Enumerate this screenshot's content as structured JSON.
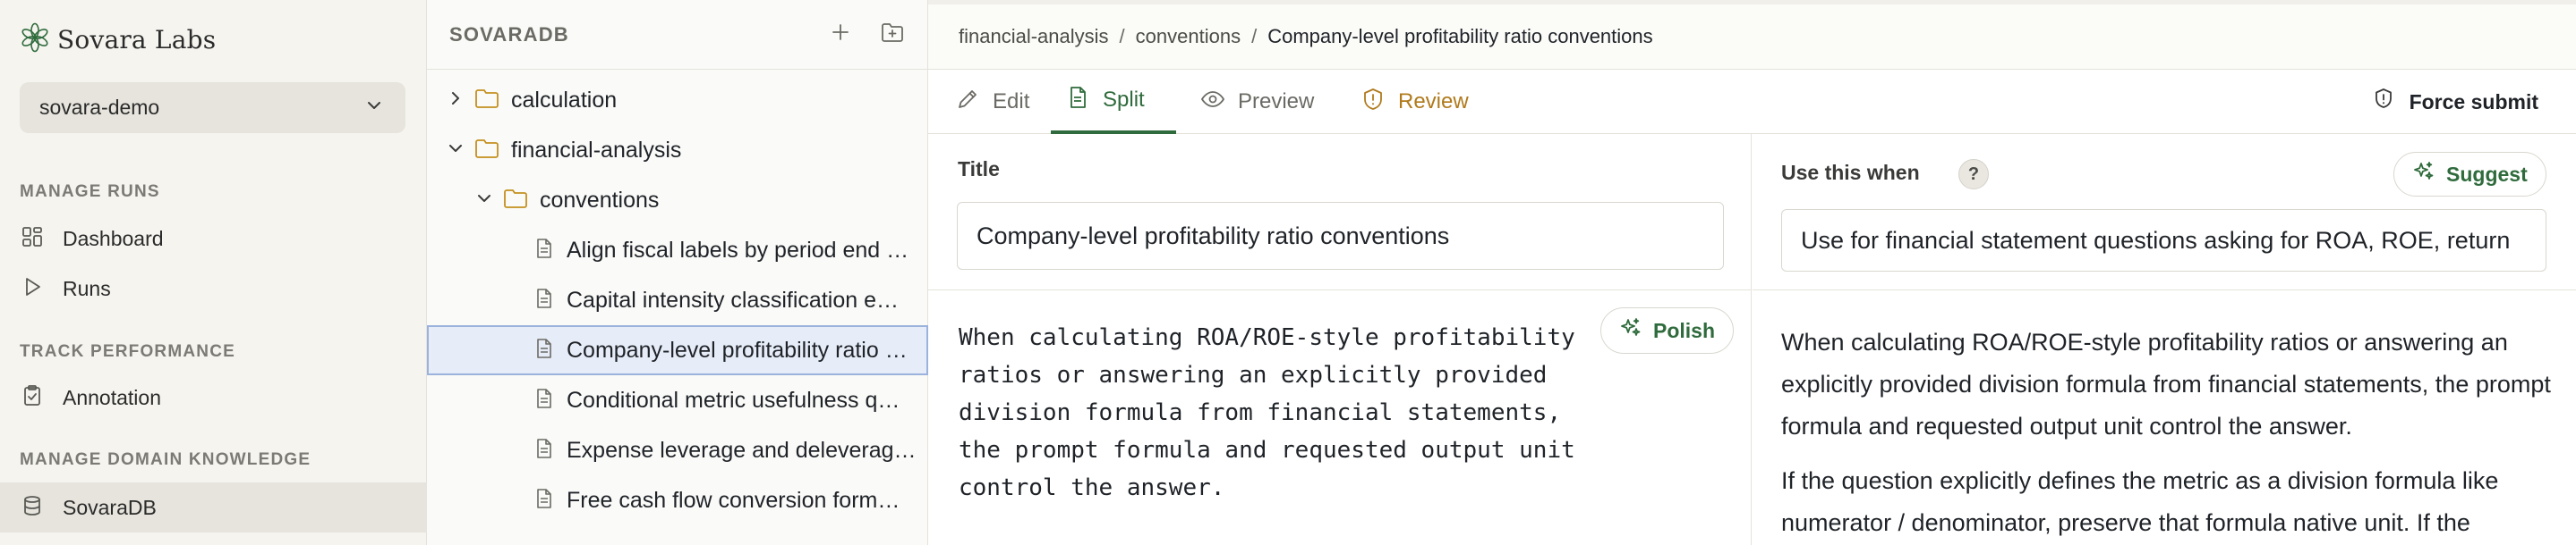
{
  "app": {
    "brand": "Sovara Labs",
    "workspace": "sovara-demo"
  },
  "sidebar": {
    "sections": [
      {
        "title": "MANAGE RUNS",
        "items": [
          {
            "label": "Dashboard",
            "icon": "dashboard-icon"
          },
          {
            "label": "Runs",
            "icon": "play-icon"
          }
        ]
      },
      {
        "title": "TRACK PERFORMANCE",
        "items": [
          {
            "label": "Annotation",
            "icon": "clipboard-check-icon"
          }
        ]
      },
      {
        "title": "MANAGE DOMAIN KNOWLEDGE",
        "items": [
          {
            "label": "SovaraDB",
            "icon": "database-icon",
            "active": true
          }
        ]
      }
    ]
  },
  "tree": {
    "title": "SOVARADB",
    "rows": [
      {
        "label": "calculation",
        "type": "folder",
        "expanded": false
      },
      {
        "label": "financial-analysis",
        "type": "folder",
        "expanded": true
      },
      {
        "label": "conventions",
        "type": "folder",
        "expanded": true
      },
      {
        "label": "Align fiscal labels by period end …",
        "type": "doc"
      },
      {
        "label": "Capital intensity classification e…",
        "type": "doc"
      },
      {
        "label": "Company-level profitability ratio …",
        "type": "doc",
        "selected": true
      },
      {
        "label": "Conditional metric usefulness q…",
        "type": "doc"
      },
      {
        "label": "Expense leverage and deleverag…",
        "type": "doc"
      },
      {
        "label": "Free cash flow conversion form…",
        "type": "doc"
      }
    ]
  },
  "breadcrumb": {
    "items": [
      "financial-analysis",
      "conventions"
    ],
    "current": "Company-level profitability ratio conventions",
    "separator": "/"
  },
  "toolbar": {
    "tabs": [
      {
        "label": "Edit",
        "icon": "pencil-icon"
      },
      {
        "label": "Split",
        "icon": "file-text-icon",
        "active": true
      },
      {
        "label": "Preview",
        "icon": "eye-icon"
      },
      {
        "label": "Review",
        "icon": "alert-circle-icon"
      }
    ],
    "force_submit": "Force submit"
  },
  "editor": {
    "title_label": "Title",
    "title_value": "Company-level profitability ratio conventions",
    "body": "When calculating ROA/ROE-style profitability\nratios or answering an explicitly provided\ndivision formula from financial statements,\nthe prompt formula and requested output unit\ncontrol the answer.",
    "polish_label": "Polish"
  },
  "preview": {
    "use_when_label": "Use this when",
    "help": "?",
    "suggest_label": "Suggest",
    "use_when_value": "Use for financial statement questions asking for ROA, ROE, return",
    "paragraphs": [
      "When calculating ROA/ROE-style profitability ratios or answering an explicitly provided division formula from financial statements, the prompt formula and requested output unit control the answer.",
      "If the question explicitly defines the metric as a division formula like numerator / denominator, preserve that formula native unit. If the"
    ]
  },
  "colors": {
    "accent_green": "#2f6b3c",
    "review_amber": "#b07a1c",
    "sidebar_bg": "#f5f4ef",
    "selected_bg": "#e7edf8"
  }
}
